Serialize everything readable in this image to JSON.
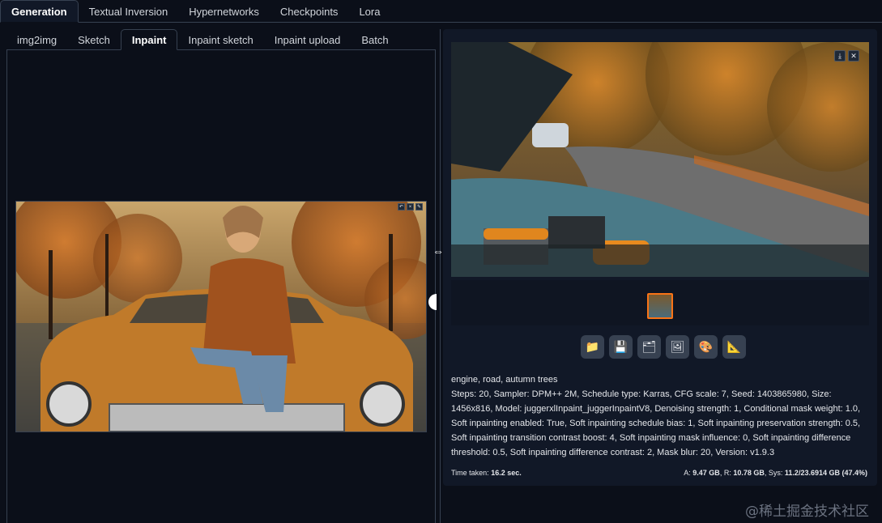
{
  "top_tabs": [
    "Generation",
    "Textual Inversion",
    "Hypernetworks",
    "Checkpoints",
    "Lora"
  ],
  "active_top_tab": "Generation",
  "sub_tabs": [
    "img2img",
    "Sketch",
    "Inpaint",
    "Inpaint sketch",
    "Inpaint upload",
    "Batch"
  ],
  "active_sub_tab": "Inpaint",
  "output": {
    "caption": "engine, road, autumn trees",
    "params": "Steps: 20, Sampler: DPM++ 2M, Schedule type: Karras, CFG scale: 7, Seed: 1403865980, Size: 1456x816, Model: juggerxlInpaint_juggerInpaintV8, Denoising strength: 1, Conditional mask weight: 1.0, Soft inpainting enabled: True, Soft inpainting schedule bias: 1, Soft inpainting preservation strength: 0.5, Soft inpainting transition contrast boost: 4, Soft inpainting mask influence: 0, Soft inpainting difference threshold: 0.5, Soft inpainting difference contrast: 2, Mask blur: 20, Version: v1.9.3",
    "time_label": "Time taken:",
    "time_value": "16.2 sec.",
    "mem_a_label": "A:",
    "mem_a": "9.47 GB",
    "mem_r_label": "R:",
    "mem_r": "10.78 GB",
    "mem_sys_label": "Sys:",
    "mem_sys": "11.2/23.6914 GB (47.4%)"
  },
  "action_icons": [
    "folder-icon",
    "save-icon",
    "zip-icon",
    "send-to-img2img-icon",
    "send-to-inpaint-icon",
    "send-to-extras-icon"
  ],
  "watermark": "@稀土掘金技术社区",
  "colors": {
    "accent": "#f97316",
    "background": "#0b0f19",
    "panel": "#111827"
  }
}
